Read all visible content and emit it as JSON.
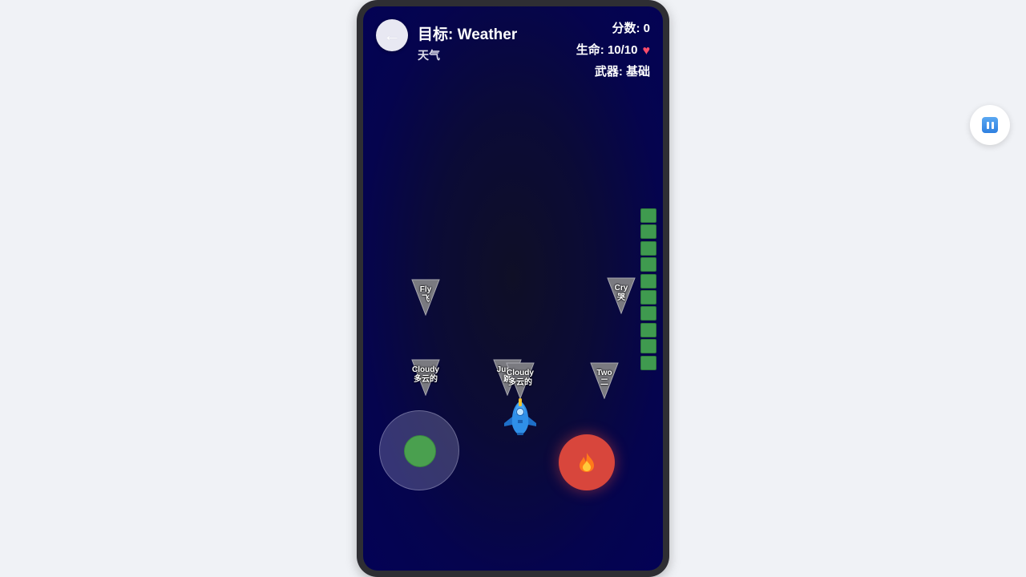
{
  "header": {
    "back_icon": "←",
    "target": "目标: Weather",
    "target_translation": "天气"
  },
  "hud": {
    "score": "分数: 0",
    "lives": "生命: 10/10",
    "weapon": "武器: 基础",
    "heart_icon": "♥"
  },
  "ammo": {
    "cells": 10,
    "color": "#3f9a4f"
  },
  "enemies": [
    {
      "word": "Fly",
      "translation": "飞"
    },
    {
      "word": "Cry",
      "translation": "哭"
    },
    {
      "word": "Cloudy",
      "translation": "多云的"
    },
    {
      "word": "Jump",
      "translation": "跳"
    },
    {
      "word": "Cloudy",
      "translation": "多云的"
    },
    {
      "word": "Two",
      "translation": "二"
    }
  ],
  "controls": {
    "fire_icon": "flame-icon",
    "pause_icon": "pause-icon",
    "joystick_color": "#4aa04f",
    "fire_color": "#d8463c"
  },
  "colors": {
    "background": "#f0f2f6",
    "screen_bg": "#05044e",
    "enemy": "#7a7a80",
    "ship": "#2f8fe8"
  }
}
